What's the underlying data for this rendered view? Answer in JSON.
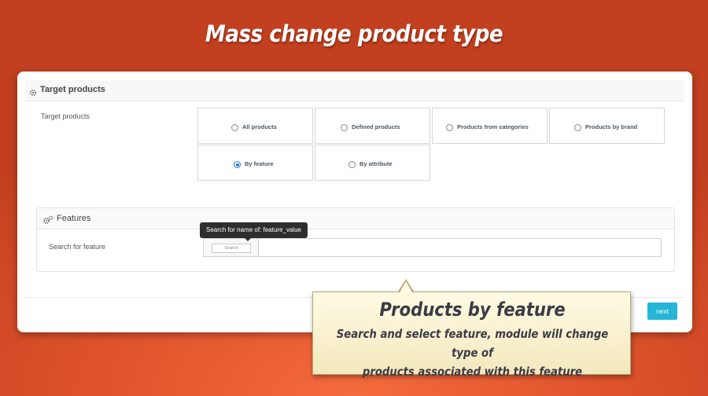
{
  "banner": {
    "title": "Mass change product type"
  },
  "panel": {
    "header_title": "Target products",
    "target_label": "Target products",
    "options": [
      {
        "label": "All products",
        "checked": false
      },
      {
        "label": "Defined products",
        "checked": false
      },
      {
        "label": "Products from categories",
        "checked": false
      },
      {
        "label": "Products by brand",
        "checked": false
      },
      {
        "label": "By feature",
        "checked": true
      },
      {
        "label": "By attribute",
        "checked": false
      }
    ],
    "next_label": "next"
  },
  "features": {
    "header_title": "Features",
    "search_label": "Search for feature",
    "search_mini_placeholder": "Search",
    "search_value": "",
    "tooltip": "Search for name of: feature_value"
  },
  "callout": {
    "title": "Products by feature",
    "description_line1": "Search and select feature, module will change type of",
    "description_line2": "products associated with this feature"
  },
  "colors": {
    "background": "#e0542d",
    "accent_button": "#25b5d6",
    "radio_checked": "#2f7bd6",
    "callout_fill": "#fffbe4"
  },
  "icons": {
    "panel_header": "gear-icon",
    "features_header": "cogs-icon"
  }
}
